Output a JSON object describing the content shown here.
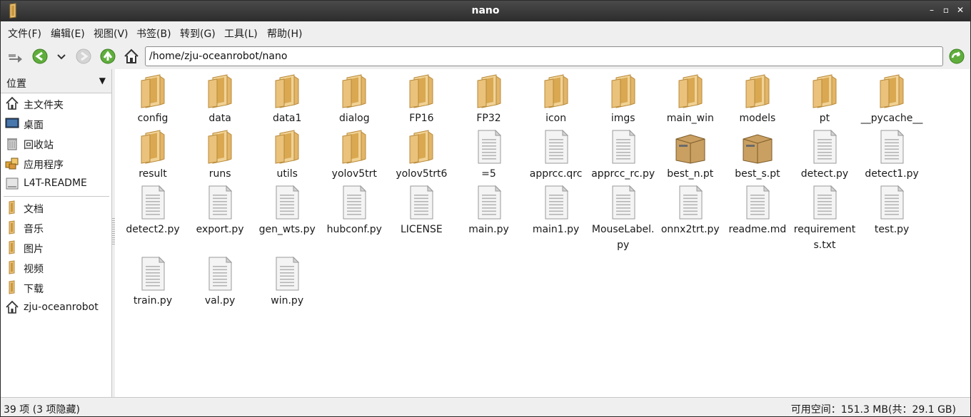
{
  "window": {
    "title": "nano"
  },
  "menu": [
    "文件(F)",
    "编辑(E)",
    "视图(V)",
    "书签(B)",
    "转到(G)",
    "工具(L)",
    "帮助(H)"
  ],
  "toolbar": {
    "path": "/home/zju-oceanrobot/nano"
  },
  "sidebar": {
    "header": "位置",
    "places": [
      {
        "label": "主文件夹",
        "icon": "home-icon"
      },
      {
        "label": "桌面",
        "icon": "desktop-icon"
      },
      {
        "label": "回收站",
        "icon": "trash-icon"
      },
      {
        "label": "应用程序",
        "icon": "applications-icon"
      },
      {
        "label": "L4T-README",
        "icon": "drive-icon"
      }
    ],
    "bookmarks": [
      {
        "label": "文档",
        "icon": "folder-icon"
      },
      {
        "label": "音乐",
        "icon": "folder-icon"
      },
      {
        "label": "图片",
        "icon": "folder-icon"
      },
      {
        "label": "视频",
        "icon": "folder-icon"
      },
      {
        "label": "下载",
        "icon": "folder-icon"
      },
      {
        "label": "zju-oceanrobot",
        "icon": "home-icon"
      }
    ]
  },
  "files": [
    {
      "name": "config",
      "type": "folder"
    },
    {
      "name": "data",
      "type": "folder"
    },
    {
      "name": "data1",
      "type": "folder"
    },
    {
      "name": "dialog",
      "type": "folder"
    },
    {
      "name": "FP16",
      "type": "folder"
    },
    {
      "name": "FP32",
      "type": "folder"
    },
    {
      "name": "icon",
      "type": "folder"
    },
    {
      "name": "imgs",
      "type": "folder"
    },
    {
      "name": "main_win",
      "type": "folder"
    },
    {
      "name": "models",
      "type": "folder"
    },
    {
      "name": "pt",
      "type": "folder"
    },
    {
      "name": "__pycache__",
      "type": "folder"
    },
    {
      "name": "result",
      "type": "folder"
    },
    {
      "name": "runs",
      "type": "folder"
    },
    {
      "name": "utils",
      "type": "folder"
    },
    {
      "name": "yolov5trt",
      "type": "folder"
    },
    {
      "name": "yolov5trt6",
      "type": "folder"
    },
    {
      "name": "=5",
      "type": "text"
    },
    {
      "name": "apprcc.qrc",
      "type": "text"
    },
    {
      "name": "apprcc_rc.py",
      "type": "text"
    },
    {
      "name": "best_n.pt",
      "type": "archive"
    },
    {
      "name": "best_s.pt",
      "type": "archive"
    },
    {
      "name": "detect.py",
      "type": "text"
    },
    {
      "name": "detect1.py",
      "type": "text"
    },
    {
      "name": "detect2.py",
      "type": "text"
    },
    {
      "name": "export.py",
      "type": "text"
    },
    {
      "name": "gen_wts.py",
      "type": "text"
    },
    {
      "name": "hubconf.py",
      "type": "text"
    },
    {
      "name": "LICENSE",
      "type": "text"
    },
    {
      "name": "main.py",
      "type": "text"
    },
    {
      "name": "main1.py",
      "type": "text"
    },
    {
      "name": "MouseLabel.py",
      "type": "text"
    },
    {
      "name": "onnx2trt.py",
      "type": "text"
    },
    {
      "name": "readme.md",
      "type": "text"
    },
    {
      "name": "requirements.txt",
      "type": "text"
    },
    {
      "name": "test.py",
      "type": "text"
    },
    {
      "name": "train.py",
      "type": "text"
    },
    {
      "name": "val.py",
      "type": "text"
    },
    {
      "name": "win.py",
      "type": "text"
    }
  ],
  "status": {
    "left": "39 项 (3 项隐藏)",
    "right": "可用空间：151.3 MB(共：29.1 GB)"
  },
  "colors": {
    "folder": "#e8c27a",
    "folder_dark": "#c9983e",
    "titlebar": "#333333"
  }
}
